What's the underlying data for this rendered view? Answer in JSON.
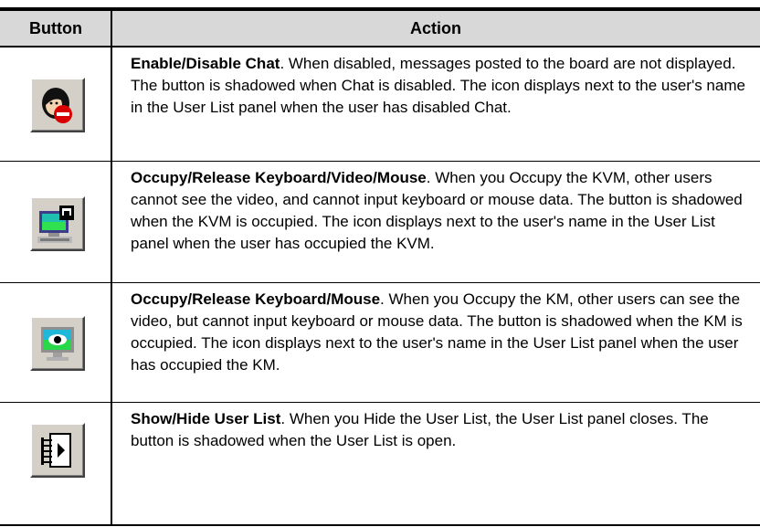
{
  "header": {
    "button": "Button",
    "action": "Action"
  },
  "rows": [
    {
      "icon": "disable-chat-icon",
      "title": "Enable/Disable Chat",
      "text": ". When disabled, messages posted to the board are not displayed. The button is shadowed when Chat is disabled. The icon displays next to the user's name in the User List panel when the user has disabled Chat."
    },
    {
      "icon": "occupy-kvm-icon",
      "title": "Occupy/Release Keyboard/Video/Mouse",
      "text": ". When you Occupy the KVM, other users cannot see the video, and cannot input keyboard or mouse data. The button is shadowed when the KVM is occupied. The icon displays next to the user's name in the User List panel when the user has occupied the KVM."
    },
    {
      "icon": "occupy-km-icon",
      "title": "Occupy/Release Keyboard/Mouse",
      "text": ". When you Occupy the KM, other users can see the video, but cannot input keyboard or mouse data. The button is shadowed when the KM is occupied. The icon displays next to the user's name in the User List panel when the user has occupied the KM."
    },
    {
      "icon": "user-list-icon",
      "title": "Show/Hide User List",
      "text": ". When you Hide the User List, the User List panel closes. The button is shadowed when the User List is open."
    }
  ]
}
